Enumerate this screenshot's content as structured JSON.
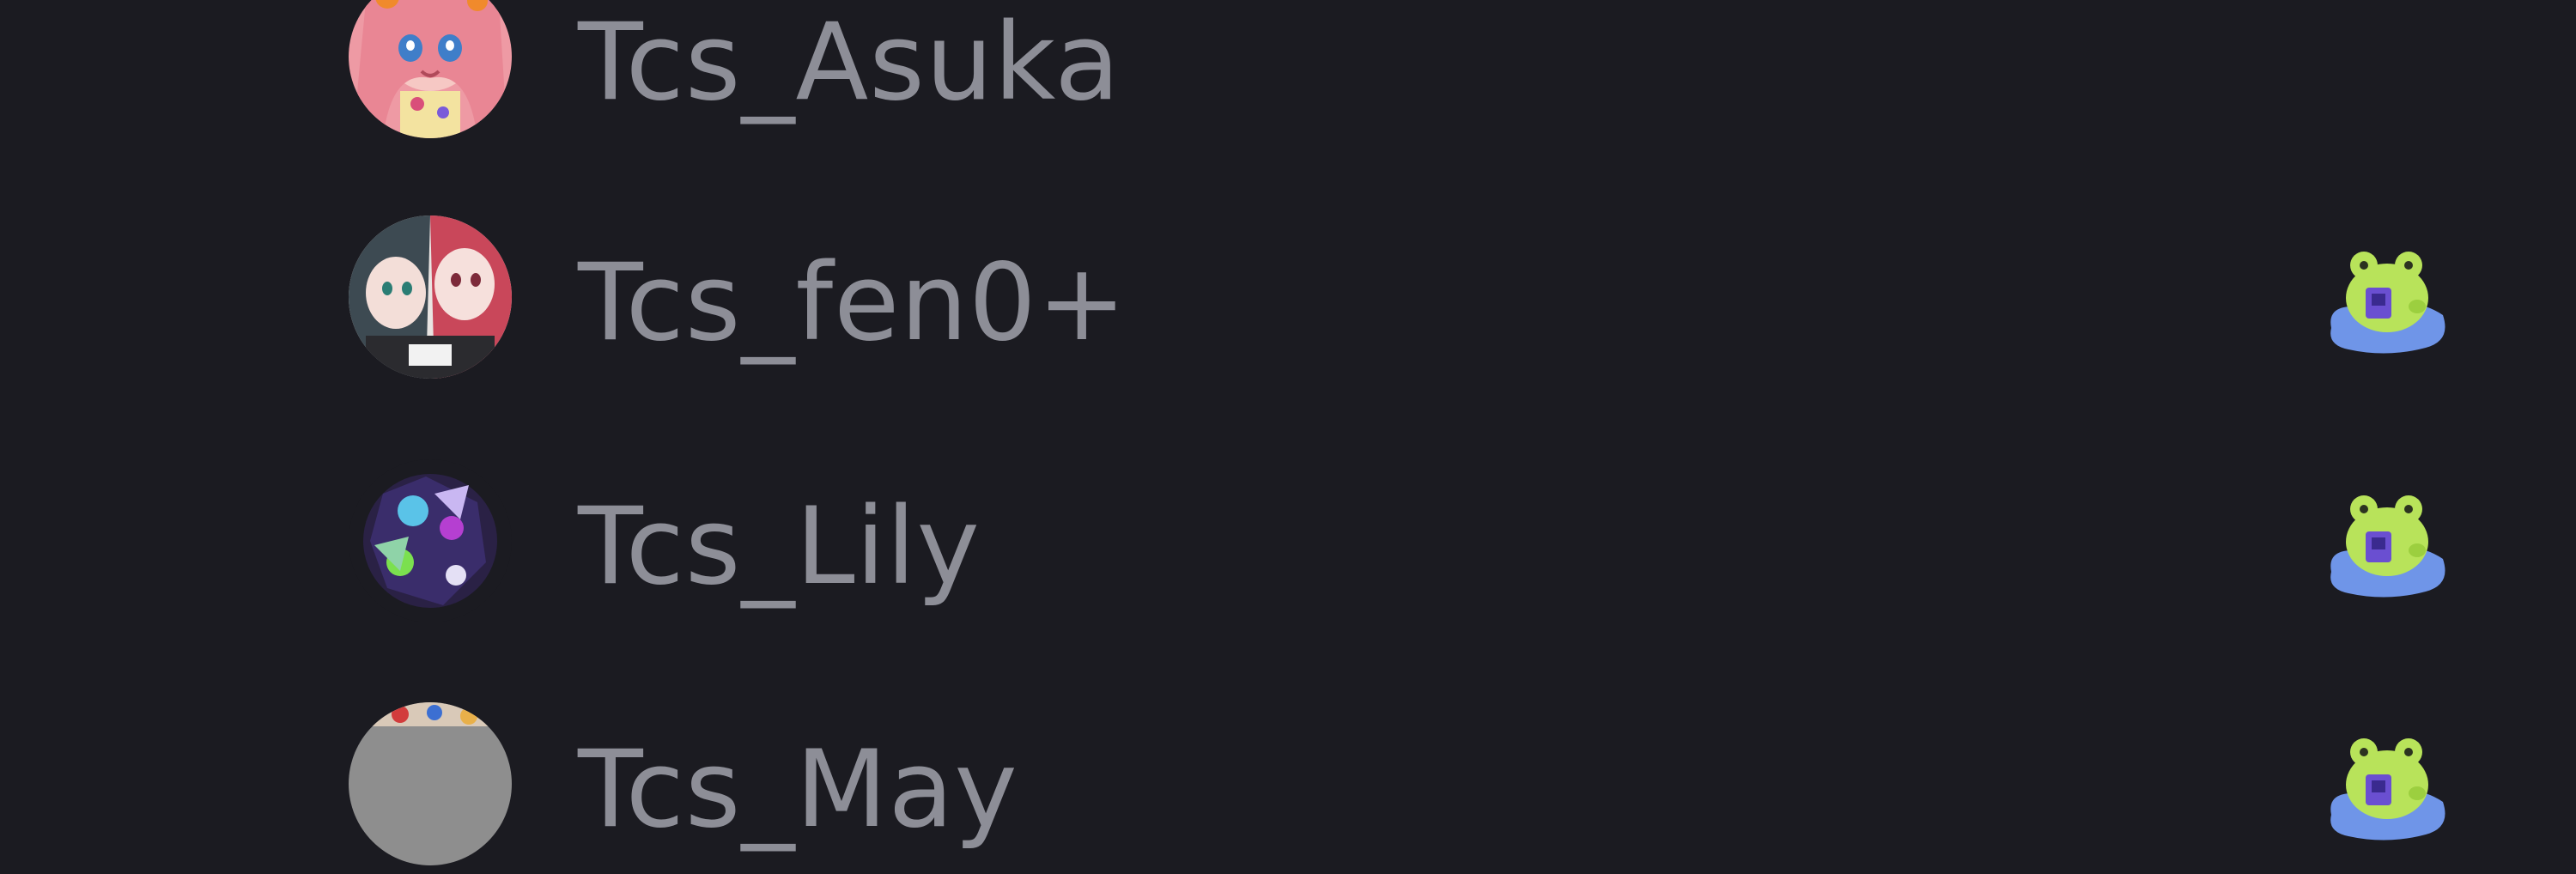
{
  "members": [
    {
      "name": "Tcs_Asuka",
      "avatar": "anime-avatar-pink",
      "activity_icon": null
    },
    {
      "name": "Tcs_fen0+",
      "avatar": "anime-avatar-duo",
      "activity_icon": "frog-mascot-icon"
    },
    {
      "name": "Tcs_Lily",
      "avatar": "anime-avatar-dark",
      "activity_icon": "frog-mascot-icon"
    },
    {
      "name": "Tcs_May",
      "avatar": "avatar-partially-loaded",
      "activity_icon": "frog-mascot-icon"
    }
  ],
  "colors": {
    "background": "#1b1b21",
    "name_text": "#8d8e97",
    "frog_green": "#b8e35a",
    "lilypad_blue": "#6f95e8",
    "cup_purple": "#6a4fd1"
  }
}
